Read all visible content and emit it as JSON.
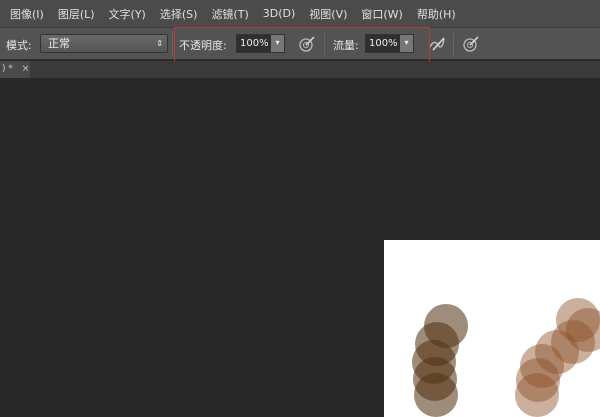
{
  "menu": [
    "图像(I)",
    "图层(L)",
    "文字(Y)",
    "选择(S)",
    "滤镜(T)",
    "3D(D)",
    "视图(V)",
    "窗口(W)",
    "帮助(H)"
  ],
  "options": {
    "mode_label": "模式:",
    "mode_value": "正常",
    "opacity_label": "不透明度:",
    "opacity_value": "100%",
    "flow_label": "流量:",
    "flow_value": "100%"
  },
  "tab": {
    "label": ") *",
    "close": "×"
  },
  "colors": {
    "highlight": "#b8393a",
    "brush_dark": "#50300f",
    "brush_light": "#8c5028"
  }
}
